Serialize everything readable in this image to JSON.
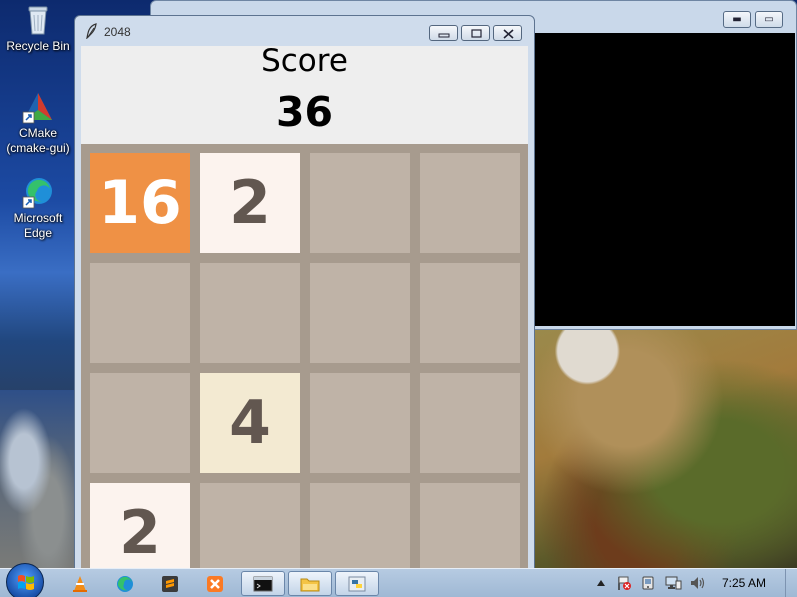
{
  "desktop": {
    "icons": [
      {
        "label": "Recycle Bin",
        "icon": "recycle-bin-icon"
      },
      {
        "label": "CMake (cmake-gui)",
        "icon": "cmake-icon"
      },
      {
        "label": "Microsoft Edge",
        "icon": "edge-icon"
      }
    ]
  },
  "game_window": {
    "title": "2048",
    "controls": [
      "minimize",
      "maximize",
      "close"
    ],
    "score_label": "Score",
    "score_value": "36",
    "board": {
      "rows": [
        [
          "16",
          "2",
          "",
          ""
        ],
        [
          "",
          "",
          "",
          ""
        ],
        [
          "",
          "4",
          "",
          ""
        ],
        [
          "2",
          "",
          "",
          ""
        ]
      ]
    },
    "colors": {
      "board_bg": "#a79b8e",
      "empty": "#bfb3a7",
      "tile_2": "#fcf3ee",
      "tile_4": "#f3ead2",
      "tile_16": "#ef9145",
      "dark_text": "#625750",
      "light_text": "#ffffff"
    }
  },
  "taskbar": {
    "clock": "7:25 AM",
    "pinned": [
      "vlc-icon",
      "edge-icon",
      "sublime-icon",
      "xampp-icon",
      "cmd-icon",
      "explorer-icon",
      "python-icon"
    ]
  }
}
